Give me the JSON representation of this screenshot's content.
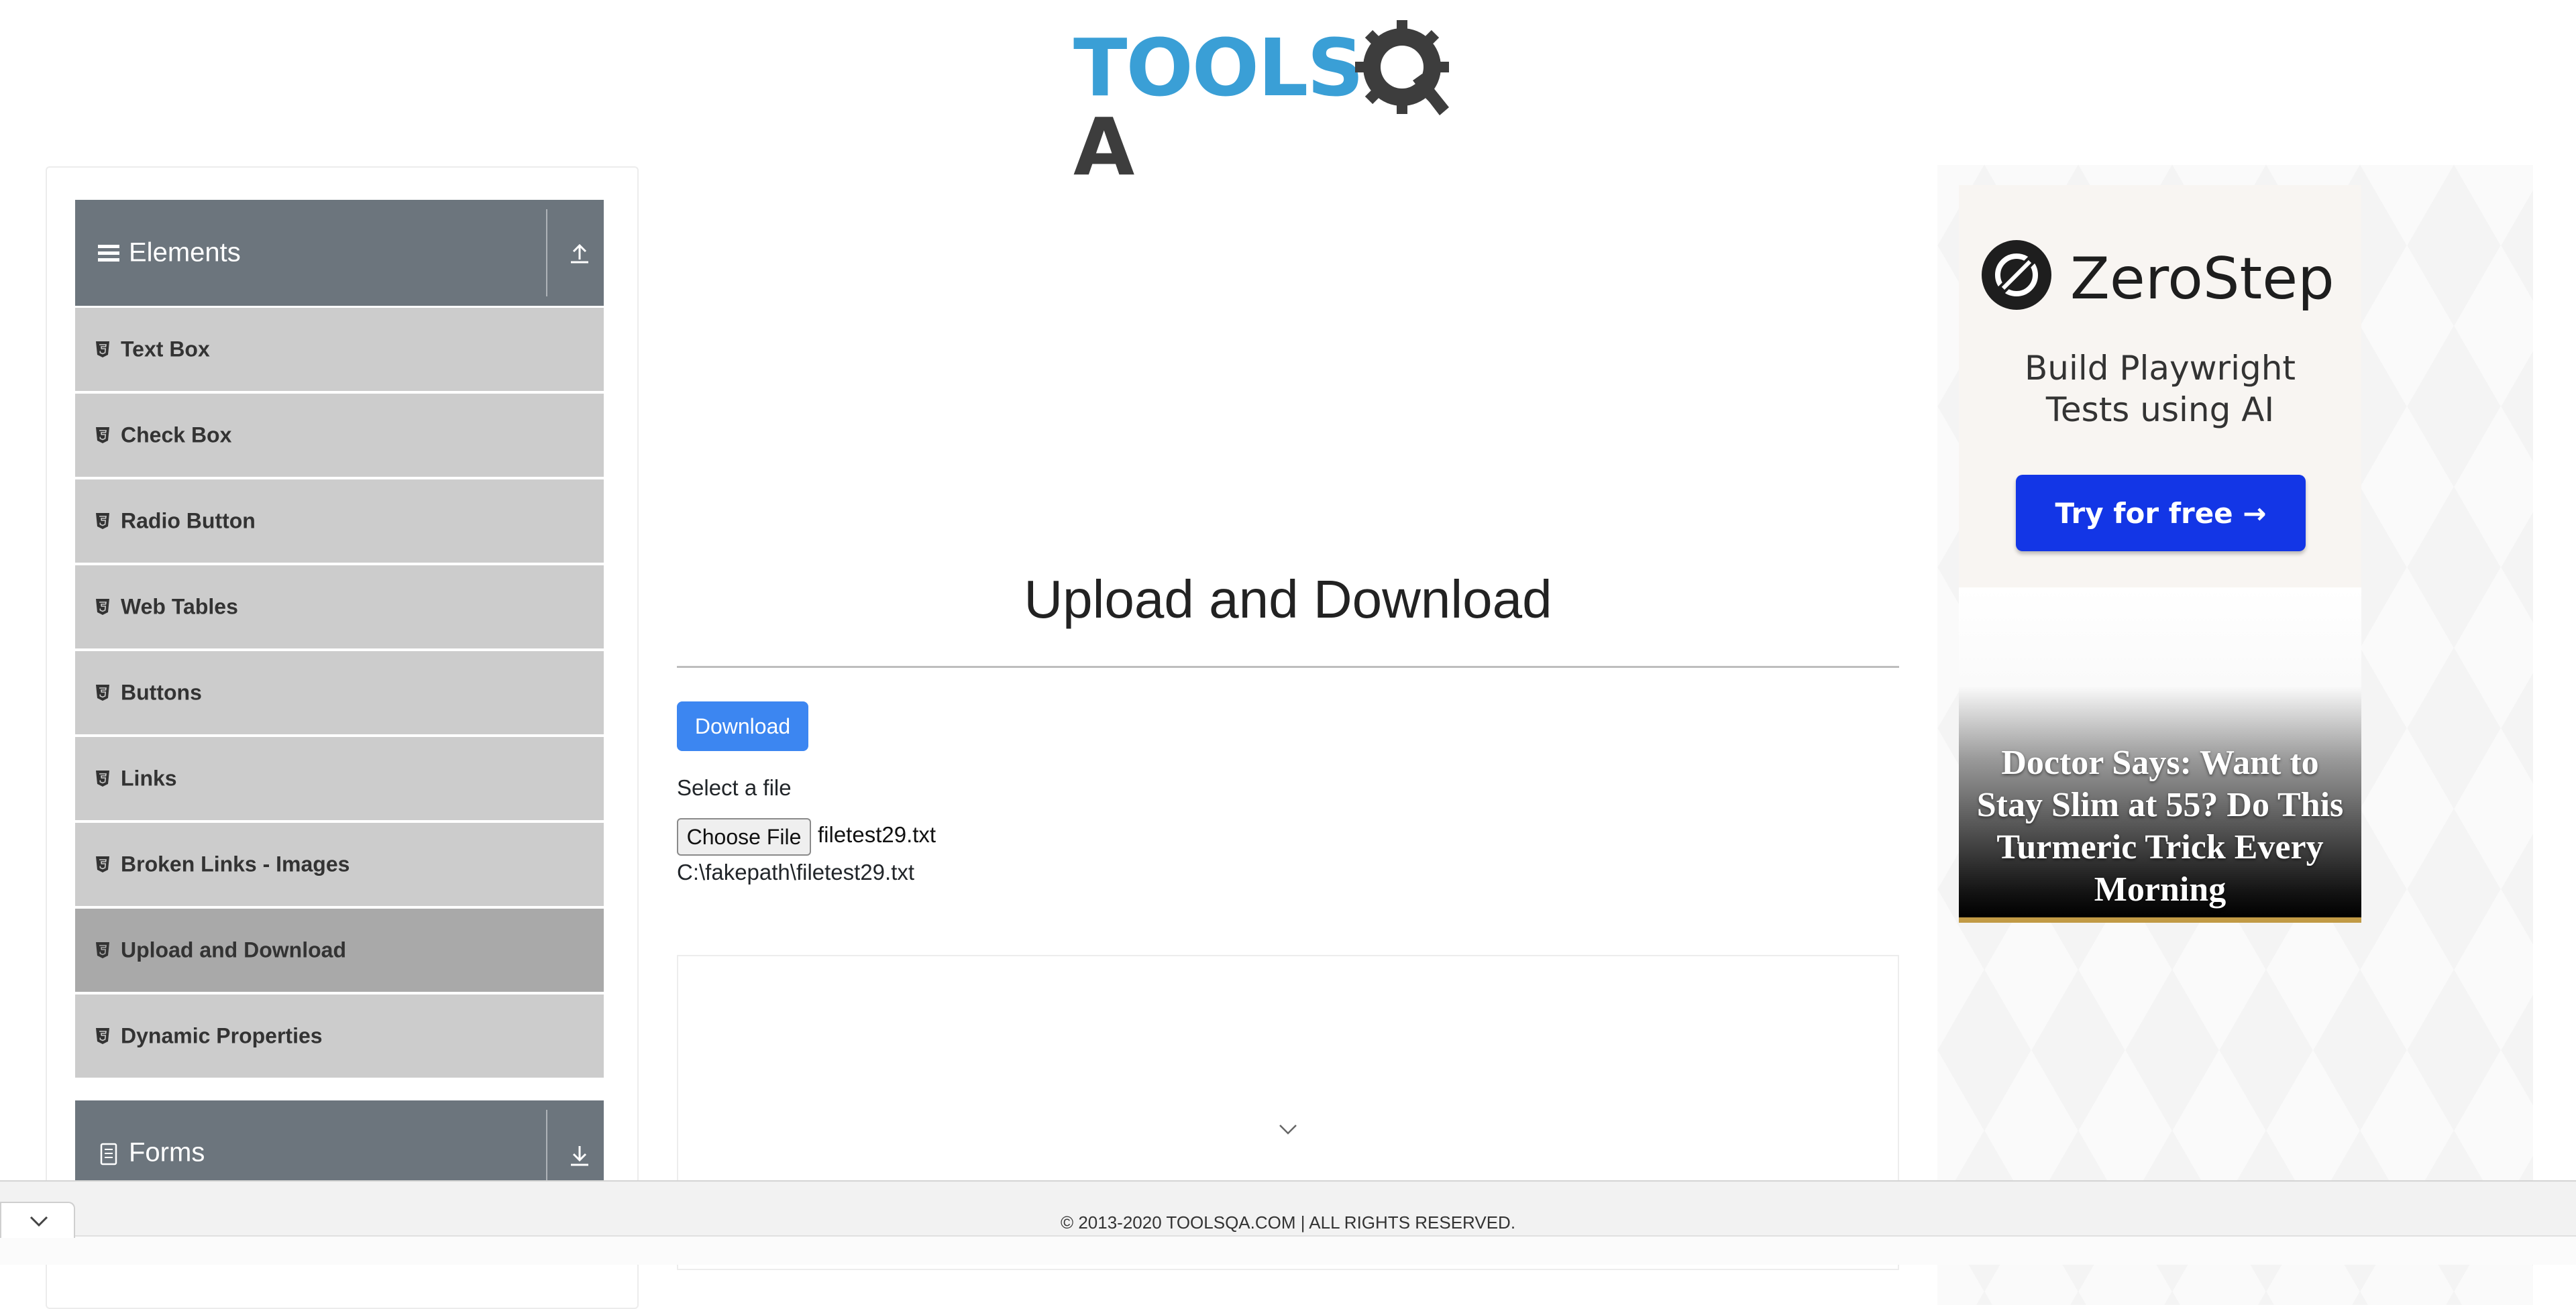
{
  "logo": {
    "part1": "TOOLS",
    "part2": "A"
  },
  "sidebar": {
    "groups": [
      {
        "title": "Elements"
      },
      {
        "title": "Forms"
      }
    ],
    "items": [
      {
        "label": "Text Box"
      },
      {
        "label": "Check Box"
      },
      {
        "label": "Radio Button"
      },
      {
        "label": "Web Tables"
      },
      {
        "label": "Buttons"
      },
      {
        "label": "Links"
      },
      {
        "label": "Broken Links - Images"
      },
      {
        "label": "Upload and Download",
        "active": true
      },
      {
        "label": "Dynamic Properties"
      }
    ]
  },
  "main": {
    "title": "Upload and Download",
    "download_label": "Download",
    "select_label": "Select a file",
    "choose_file_label": "Choose File",
    "chosen_file": "filetest29.txt",
    "uploaded_path": "C:\\fakepath\\filetest29.txt"
  },
  "ad_zerostep": {
    "brand": "ZeroStep",
    "tagline_line1": "Build Playwright",
    "tagline_line2": "Tests using AI",
    "cta": "Try for free →"
  },
  "ad_turmeric": {
    "headline": "Doctor Says: Want to Stay Slim at 55? Do This Turmeric Trick Every Morning"
  },
  "footer": {
    "copyright": "© 2013-2020 TOOLSQA.COM | ALL RIGHTS RESERVED."
  },
  "colors": {
    "sidebar_header": "#6c757d",
    "menu_item": "#cccccc",
    "menu_item_active": "#a9a9a9",
    "primary_button": "#3c86f1",
    "logo_blue": "#3a9fd6",
    "zerostep_cta": "#1336e6"
  },
  "icons": {
    "elements_group": "hamburger-icon",
    "forms_group": "document-icon",
    "expand_up": "upload-arrow-icon",
    "expand_down": "download-arrow-icon",
    "menu_item": "html5-shield-icon",
    "collapse": "chevron-down-icon"
  }
}
